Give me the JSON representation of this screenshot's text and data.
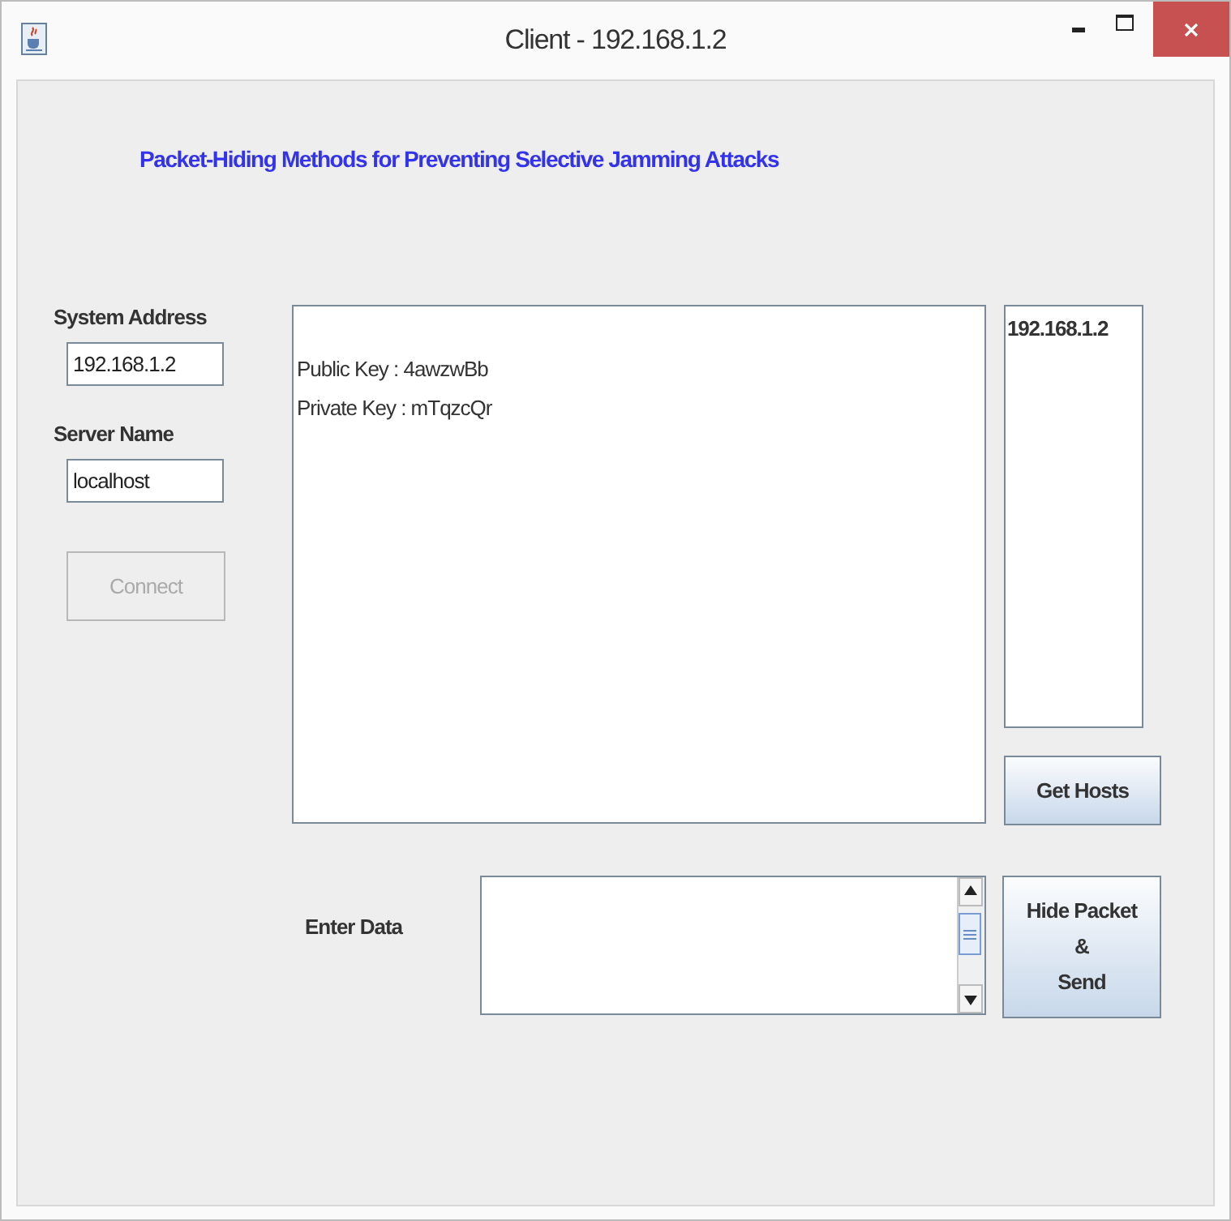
{
  "window": {
    "title": "Client - 192.168.1.2"
  },
  "heading": "Packet-Hiding Methods for Preventing Selective Jamming Attacks",
  "system_address": {
    "label": "System Address",
    "value": "192.168.1.2"
  },
  "server_name": {
    "label": "Server Name",
    "value": "localhost"
  },
  "connect_button": {
    "label": "Connect",
    "disabled": true
  },
  "log_area": {
    "lines": [
      "Public Key : 4awzwBb",
      "Private Key : mTqzcQr"
    ]
  },
  "hosts_list": {
    "items": [
      "192.168.1.2"
    ]
  },
  "get_hosts_button": {
    "label": "Get Hosts",
    "disabled": false
  },
  "enter_data": {
    "label": "Enter Data"
  },
  "send_button": {
    "lines": [
      "Hide Packet",
      "&",
      "Send"
    ],
    "disabled": false
  }
}
